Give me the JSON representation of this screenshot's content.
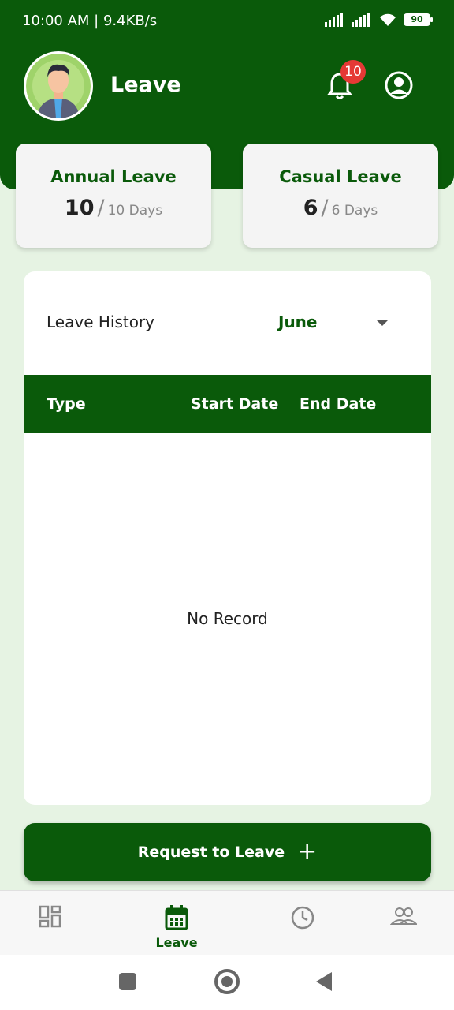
{
  "status": {
    "time": "10:00 AM | 9.4KB/s",
    "battery": "90"
  },
  "header": {
    "title": "Leave",
    "notification_count": "10"
  },
  "cards": [
    {
      "title": "Annual Leave",
      "used": "10",
      "total": "10 Days"
    },
    {
      "title": "Casual Leave",
      "used": "6",
      "total": "6 Days"
    }
  ],
  "history": {
    "title": "Leave History",
    "month": "June",
    "columns": [
      "Type",
      "Start Date",
      "End Date"
    ],
    "empty_text": "No Record"
  },
  "request_button": {
    "label": "Request to Leave",
    "icon": "plus-icon"
  },
  "bottom_nav": {
    "items": [
      {
        "icon": "dashboard-icon",
        "label": ""
      },
      {
        "icon": "calendar-icon",
        "label": "Leave",
        "active": true
      },
      {
        "icon": "clock-icon",
        "label": ""
      },
      {
        "icon": "people-icon",
        "label": ""
      }
    ]
  },
  "colors": {
    "primary": "#0a5a0a",
    "background": "#e6f3e3",
    "badge": "#e53935"
  }
}
